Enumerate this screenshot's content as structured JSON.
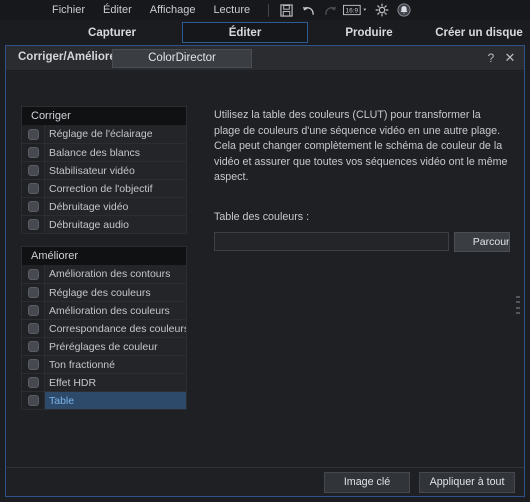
{
  "app": {
    "logo_name": "video-camera-logo",
    "accent": "#30528a",
    "selection": "#2e4a6b",
    "selection_text": "#79b3e8"
  },
  "menubar": {
    "items": [
      {
        "label": "Fichier",
        "name": "menu-fichier"
      },
      {
        "label": "Éditer",
        "name": "menu-editer"
      },
      {
        "label": "Affichage",
        "name": "menu-affichage"
      },
      {
        "label": "Lecture",
        "name": "menu-lecture"
      }
    ],
    "tools": [
      {
        "name": "save-icon"
      },
      {
        "name": "undo-icon"
      },
      {
        "name": "redo-icon"
      },
      {
        "name": "aspect-ratio-icon",
        "label": "16:9"
      },
      {
        "name": "settings-gear-icon"
      },
      {
        "name": "notification-bell-icon"
      }
    ]
  },
  "nav": {
    "tabs": [
      {
        "label": "Capturer",
        "active": false
      },
      {
        "label": "Éditer",
        "active": true
      },
      {
        "label": "Produire",
        "active": false
      },
      {
        "label": "Créer un disque",
        "active": false
      }
    ]
  },
  "panel": {
    "tab_label": "Corriger/Améliorer",
    "tab_button": "ColorDirector",
    "help_glyph": "?",
    "close_glyph": "✕"
  },
  "groups": [
    {
      "title": "Corriger",
      "items": [
        {
          "label": "Réglage de l'éclairage",
          "checked": false,
          "selected": false
        },
        {
          "label": "Balance des blancs",
          "checked": false,
          "selected": false
        },
        {
          "label": "Stabilisateur vidéo",
          "checked": false,
          "selected": false
        },
        {
          "label": "Correction de l'objectif",
          "checked": false,
          "selected": false
        },
        {
          "label": "Débruitage vidéo",
          "checked": false,
          "selected": false
        },
        {
          "label": "Débruitage audio",
          "checked": false,
          "selected": false
        }
      ]
    },
    {
      "title": "Améliorer",
      "items": [
        {
          "label": "Amélioration des contours",
          "checked": false,
          "selected": false
        },
        {
          "label": "Réglage des couleurs",
          "checked": false,
          "selected": false
        },
        {
          "label": "Amélioration des couleurs",
          "checked": false,
          "selected": false
        },
        {
          "label": "Correspondance des couleurs",
          "checked": false,
          "selected": false
        },
        {
          "label": "Préréglages de couleur",
          "checked": false,
          "selected": false
        },
        {
          "label": "Ton fractionné",
          "checked": false,
          "selected": false
        },
        {
          "label": "Effet HDR",
          "checked": false,
          "selected": false
        },
        {
          "label": "Table",
          "checked": false,
          "selected": true
        }
      ]
    }
  ],
  "content": {
    "description": "Utilisez la table des couleurs (CLUT) pour transformer la plage de couleurs d'une séquence vidéo en une autre plage. Cela peut changer complètement le schéma de couleur de la vidéo et assurer que toutes vos séquences vidéo ont le même aspect.",
    "field_label": "Table des couleurs :",
    "field_value": "",
    "field_placeholder": "",
    "browse_button": "Parcourir"
  },
  "footer": {
    "keyframe_button": "Image clé",
    "apply_all_button": "Appliquer à tout"
  }
}
